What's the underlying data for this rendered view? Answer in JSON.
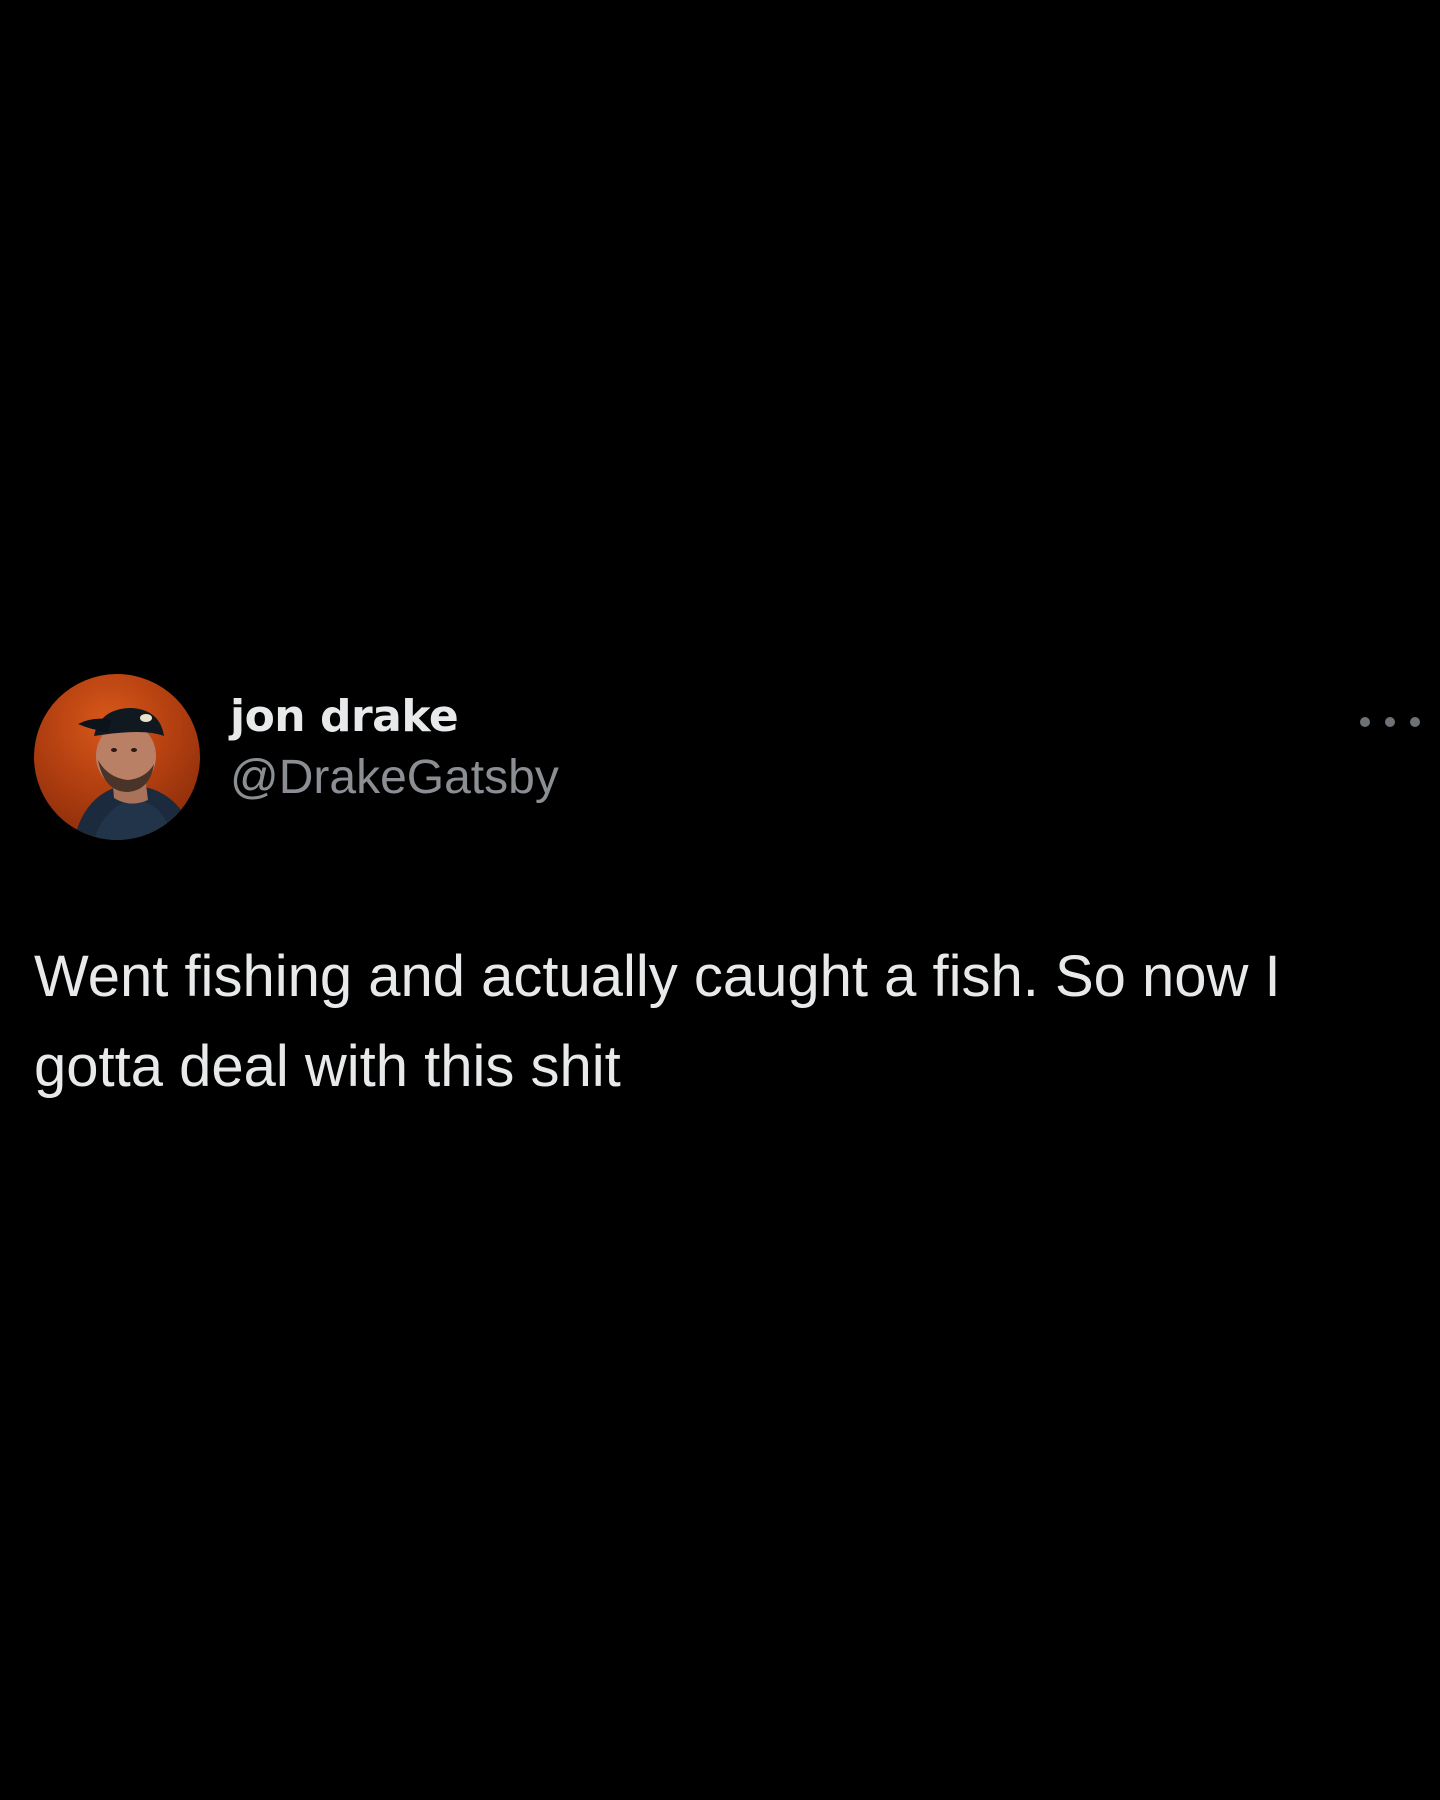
{
  "tweet": {
    "author": {
      "display_name": "jon drake",
      "handle": "@DrakeGatsby",
      "avatar_icon": "avatar-photo",
      "avatar_background": "#c4501a"
    },
    "more_icon": "ellipsis-icon",
    "text_line_1": "Went fishing and actually caught a fish. So now I",
    "text_line_2": "gotta deal with this shit"
  },
  "colors": {
    "background": "#000000",
    "primary_text": "#e7e9ea",
    "secondary_text": "#8b8f94"
  }
}
